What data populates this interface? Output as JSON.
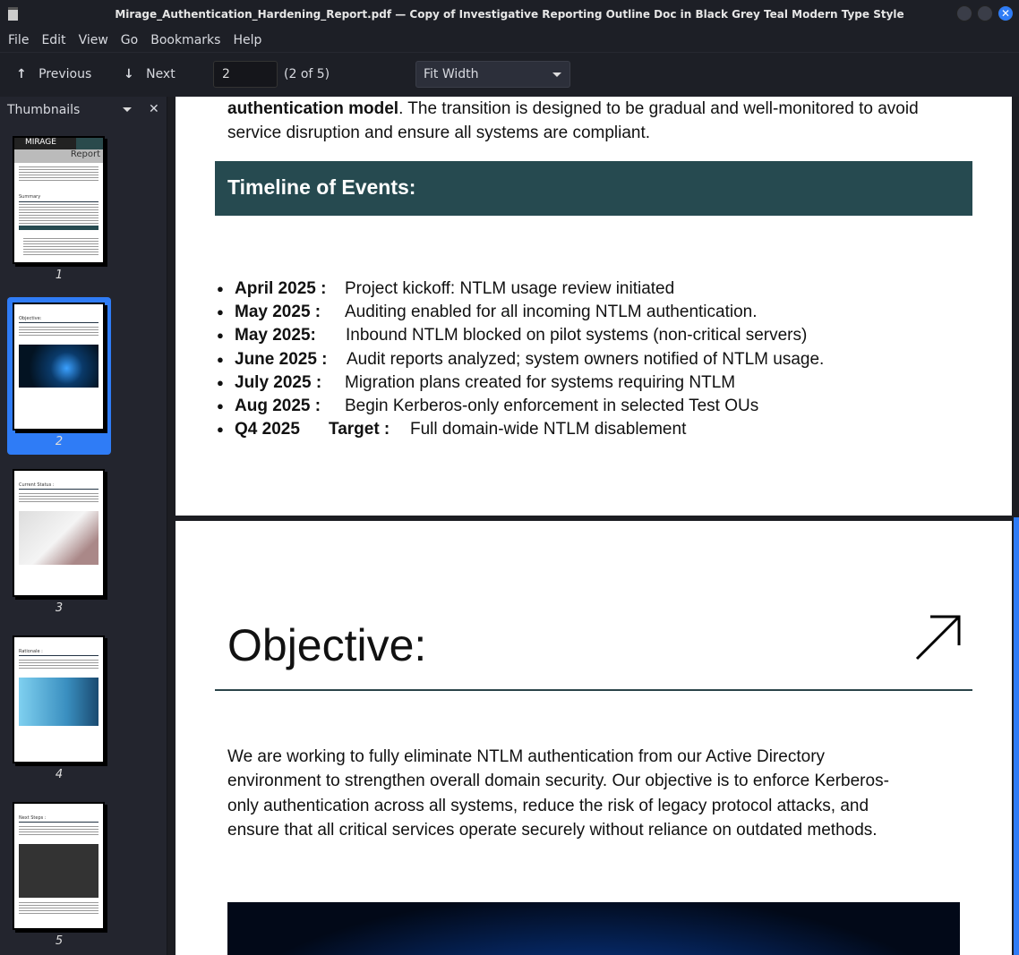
{
  "window": {
    "title": "Mirage_Authentication_Hardening_Report.pdf — Copy of Investigative Reporting Outline Doc in Black Grey Teal Modern Type Style"
  },
  "menu": [
    "File",
    "Edit",
    "View",
    "Go",
    "Bookmarks",
    "Help"
  ],
  "toolbar": {
    "previous": "Previous",
    "next": "Next",
    "page_value": "2",
    "page_count": "(2 of 5)",
    "zoom": "Fit Width"
  },
  "sidebar": {
    "title": "Thumbnails",
    "thumbs": [
      {
        "num": "1",
        "heading": "Summary",
        "top": "MIRAGE",
        "sub": "Report"
      },
      {
        "num": "2",
        "heading": "Objective:"
      },
      {
        "num": "3",
        "heading": "Current Status :"
      },
      {
        "num": "4",
        "heading": "Rationale :"
      },
      {
        "num": "5",
        "heading": "Next Steps :"
      }
    ],
    "selected": 2
  },
  "page1": {
    "bold_lead": "authentication model",
    "lead_rest": ". The transition is designed to be gradual and well-monitored to avoid",
    "line2": "service disruption and ensure all systems are compliant.",
    "timeline_heading": "Timeline of Events:",
    "timeline": [
      {
        "date": "April 2025 :",
        "text": "Project kickoff: NTLM usage review initiated"
      },
      {
        "date": "May 2025 :",
        "text": "Auditing enabled for all incoming NTLM authentication."
      },
      {
        "date": "May 2025:",
        "text": "Inbound NTLM blocked on pilot systems (non-critical servers)"
      },
      {
        "date": "June 2025 :",
        "text": "Audit reports analyzed; system owners notified of NTLM usage."
      },
      {
        "date": "July 2025 :",
        "text": "Migration plans created for systems requiring NTLM"
      },
      {
        "date": "Aug 2025 :",
        "text": "Begin Kerberos-only enforcement in selected Test OUs"
      },
      {
        "date": "Q4 2025",
        "target": "Target :",
        "text": "Full domain-wide NTLM disablement"
      }
    ]
  },
  "page2": {
    "heading": "Objective:",
    "lines": [
      "We are working to fully eliminate NTLM authentication from our Active Directory",
      "environment to strengthen overall domain security. Our objective is to enforce Kerberos-",
      "only authentication across all systems, reduce the risk of legacy protocol attacks, and",
      "ensure that all critical services operate securely without reliance on outdated methods."
    ]
  }
}
